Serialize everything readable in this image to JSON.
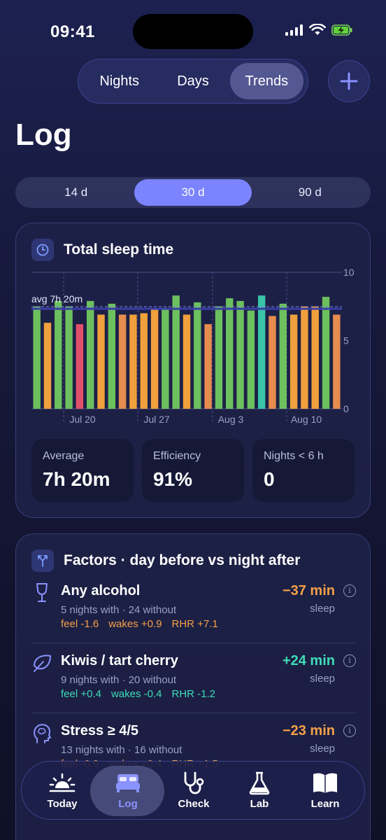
{
  "status": {
    "time": "09:41"
  },
  "top_segment": {
    "options": [
      "Nights",
      "Days",
      "Trends"
    ],
    "selected": "Trends"
  },
  "page": {
    "title": "Log"
  },
  "range": {
    "options": [
      "14 d",
      "30 d",
      "90 d"
    ],
    "selected": "30 d"
  },
  "sleep_card": {
    "title": "Total sleep time",
    "avg_label": "avg 7h 20m",
    "stats": [
      {
        "label": "Average",
        "value": "7h 20m"
      },
      {
        "label": "Efficiency",
        "value": "91%"
      },
      {
        "label": "Nights < 6 h",
        "value": "0"
      }
    ]
  },
  "chart_data": {
    "type": "bar",
    "title": "Total sleep time",
    "x_tick_labels": [
      "Jul 20",
      "Jul 27",
      "Aug 3",
      "Aug 10"
    ],
    "y_tick_labels": [
      "0",
      "5",
      "10"
    ],
    "ylim": [
      0,
      10
    ],
    "average": 7.33,
    "values": [
      7.5,
      6.3,
      7.9,
      7.5,
      6.2,
      7.9,
      6.9,
      7.7,
      6.9,
      6.9,
      7.0,
      7.3,
      7.4,
      8.3,
      6.9,
      7.8,
      6.2,
      7.5,
      8.1,
      7.9,
      7.2,
      8.3,
      6.8,
      7.7,
      6.9,
      7.5,
      7.5,
      8.2,
      6.9
    ],
    "colors": [
      "#6cc05e",
      "#f0a03c",
      "#6cc05e",
      "#6cc05e",
      "#e0506a",
      "#6cc05e",
      "#f0a03c",
      "#6cc05e",
      "#e58c4e",
      "#f0a03c",
      "#f0a03c",
      "#f0a03c",
      "#6cc05e",
      "#6cc05e",
      "#f0a03c",
      "#6cc05e",
      "#e58c4e",
      "#6cc05e",
      "#6cc05e",
      "#6cc05e",
      "#6cc05e",
      "#3ac4a8",
      "#e58c4e",
      "#6cc05e",
      "#f0a03c",
      "#f0a03c",
      "#f0a03c",
      "#6cc05e",
      "#e58c4e"
    ],
    "grid": true
  },
  "factors_card": {
    "title": "Factors · day before vs night after",
    "items": [
      {
        "icon": "wine-glass-icon",
        "name": "Any alcohol",
        "sub": "5 nights with · 24 without",
        "chips": [
          "feel -1.6",
          "wakes +0.9",
          "RHR +7.1"
        ],
        "delta": "−37 min",
        "unit": "sleep",
        "sign": "neg"
      },
      {
        "icon": "leaf-icon",
        "name": "Kiwis / tart cherry",
        "sub": "9 nights with · 20 without",
        "chips": [
          "feel +0.4",
          "wakes -0.4",
          "RHR -1.2"
        ],
        "delta": "+24 min",
        "unit": "sleep",
        "sign": "pos"
      },
      {
        "icon": "brain-head-icon",
        "name": "Stress ≥ 4/5",
        "sub": "13 nights with · 16 without",
        "chips": [
          "feel -0.9",
          "wakes +0.4",
          "RHR +1.5"
        ],
        "delta": "−23 min",
        "unit": "sleep",
        "sign": "neg"
      }
    ]
  },
  "tabbar": {
    "items": [
      {
        "label": "Today",
        "icon": "sunrise-icon"
      },
      {
        "label": "Log",
        "icon": "bed-icon"
      },
      {
        "label": "Check",
        "icon": "stethoscope-icon"
      },
      {
        "label": "Lab",
        "icon": "flask-icon"
      },
      {
        "label": "Learn",
        "icon": "book-icon"
      }
    ],
    "selected": "Log"
  },
  "colors": {
    "accent": "#7b83ff",
    "good": "#6cc05e",
    "warn": "#f0a03c",
    "bad": "#e0506a",
    "positive": "#3fdcb7"
  }
}
